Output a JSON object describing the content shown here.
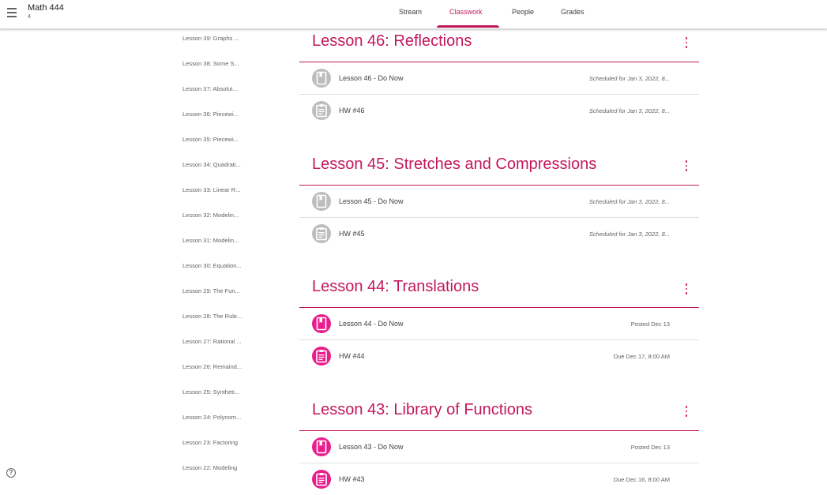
{
  "header": {
    "class_name": "Math 444",
    "class_section": "4",
    "tabs": [
      {
        "label": "Stream"
      },
      {
        "label": "Classwork"
      },
      {
        "label": "People"
      },
      {
        "label": "Grades"
      }
    ],
    "active_tab": "Classwork",
    "accent_color": "#c2185b"
  },
  "topics": [
    "Lesson 39: Graphs ...",
    "Lesson 38: Some S...",
    "Lesson 37: Absolut...",
    "Lesson 36: Piecewi...",
    "Lesson 35: Piecewi...",
    "Lesson 34: Quadrati...",
    "Lesson 33: Linear R...",
    "Lesson 32: Modelin...",
    "Lesson 31: Modelin...",
    "Lesson 30: Equation...",
    "Lesson 29: The Fun...",
    "Lesson 28: The Rule...",
    "Lesson 27: Rational ...",
    "Lesson 26: Remaind...",
    "Lesson 25: Syntheti...",
    "Lesson 24: Polynom...",
    "Lesson 23: Factoring",
    "Lesson 22: Modeling"
  ],
  "sections": [
    {
      "title": "Lesson 46: Reflections",
      "items": [
        {
          "title": "Lesson 46 - Do Now",
          "meta": "Scheduled for Jan 3, 2022, 8...",
          "icon": "material-icon",
          "state": "scheduled"
        },
        {
          "title": "HW #46",
          "meta": "Scheduled for Jan 3, 2022, 8...",
          "icon": "assignment-icon",
          "state": "scheduled"
        }
      ]
    },
    {
      "title": "Lesson 45: Stretches and Compressions",
      "items": [
        {
          "title": "Lesson 45 - Do Now",
          "meta": "Scheduled for Jan 3, 2022, 8...",
          "icon": "material-icon",
          "state": "scheduled"
        },
        {
          "title": "HW #45",
          "meta": "Scheduled for Jan 3, 2022, 8...",
          "icon": "assignment-icon",
          "state": "scheduled"
        }
      ]
    },
    {
      "title": "Lesson 44: Translations",
      "items": [
        {
          "title": "Lesson 44 - Do Now",
          "meta": "Posted Dec 13",
          "icon": "material-icon",
          "state": "posted"
        },
        {
          "title": "HW #44",
          "meta": "Due Dec 17, 8:00 AM",
          "icon": "assignment-icon",
          "state": "posted"
        }
      ]
    },
    {
      "title": "Lesson 43: Library of Functions",
      "items": [
        {
          "title": "Lesson 43 - Do Now",
          "meta": "Posted Dec 13",
          "icon": "material-icon",
          "state": "posted"
        },
        {
          "title": "HW #43",
          "meta": "Due Dec 16, 8:00 AM",
          "icon": "assignment-icon",
          "state": "posted"
        }
      ]
    }
  ],
  "help_icon": "help-icon"
}
